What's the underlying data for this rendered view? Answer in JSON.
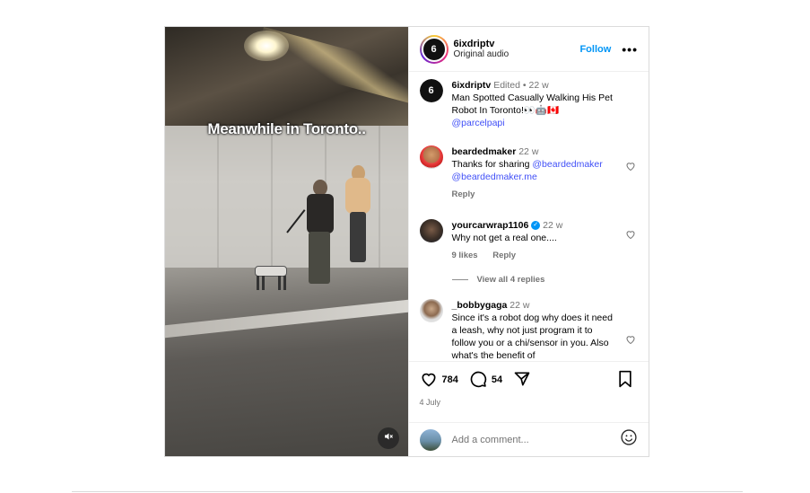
{
  "post": {
    "video": {
      "caption": "Meanwhile in Toronto..",
      "mute_icon": "speaker-muted-icon"
    },
    "header": {
      "username": "6ixdriptv",
      "audio": "Original audio",
      "follow_label": "Follow",
      "more_label": "•••"
    },
    "caption": {
      "username": "6ixdriptv",
      "edited": "Edited",
      "separator": "•",
      "time": "22 w",
      "text": "Man Spotted Casually Walking His Pet Robot In Toronto!👀🤖🇨🇦",
      "mention": "@parcelpapi"
    },
    "comments": [
      {
        "username": "beardedmaker",
        "time": "22 w",
        "text": "Thanks for sharing ",
        "mention1": "@beardedmaker",
        "mention2": "@beardedmaker.me",
        "reply_label": "Reply"
      },
      {
        "username": "yourcarwrap1106",
        "verified": true,
        "time": "22 w",
        "text": "Why not get a real one....",
        "likes": "9 likes",
        "reply_label": "Reply",
        "view_replies": "View all 4 replies"
      },
      {
        "username": "_bobbygaga",
        "time": "22 w",
        "text": "Since it's a robot dog why does it need a leash, why not just program it to follow you or a chi/sensor in you. Also what's the benefit of"
      }
    ],
    "actions": {
      "likes": "784",
      "comments": "54",
      "date": "4 July"
    },
    "add_comment": {
      "placeholder": "Add a comment..."
    }
  },
  "colors": {
    "accent_blue": "#0095f6",
    "mention": "#4150f7",
    "muted_text": "#737373",
    "border": "#dbdbdb"
  }
}
